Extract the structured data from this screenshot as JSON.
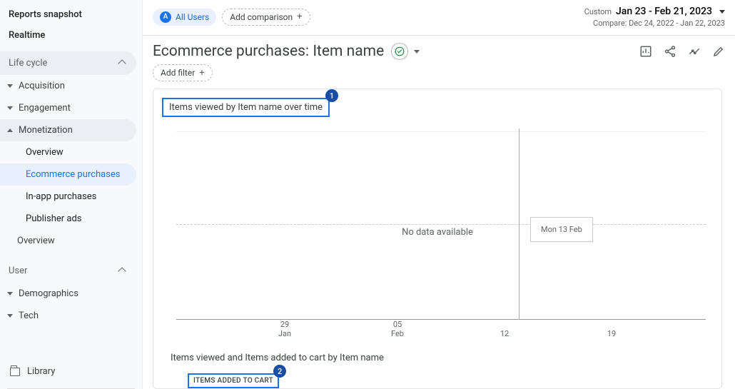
{
  "sidebar": {
    "top": [
      {
        "label": "Reports snapshot"
      },
      {
        "label": "Realtime"
      }
    ],
    "sections": [
      {
        "label": "Life cycle",
        "items": [
          {
            "label": "Acquisition"
          },
          {
            "label": "Engagement"
          },
          {
            "label": "Monetization",
            "expanded": true,
            "children": [
              {
                "label": "Overview"
              },
              {
                "label": "Ecommerce purchases",
                "selected": true
              },
              {
                "label": "In-app purchases"
              },
              {
                "label": "Publisher ads"
              }
            ]
          },
          {
            "label": "Overview"
          }
        ]
      },
      {
        "label": "User",
        "items": [
          {
            "label": "Demographics"
          },
          {
            "label": "Tech"
          }
        ]
      }
    ],
    "library_label": "Library"
  },
  "topbar": {
    "segment_letter": "A",
    "segment_label": "All Users",
    "add_comparison_label": "Add comparison",
    "custom_label": "Custom",
    "date_range": "Jan 23 - Feb 21, 2023",
    "compare_label": "Compare: Dec 24, 2022 - Jan 22, 2023"
  },
  "page": {
    "title": "Ecommerce purchases: Item name",
    "add_filter_label": "Add filter"
  },
  "callouts": {
    "one": "1",
    "two": "2"
  },
  "card1": {
    "title": "Items viewed by Item name over time",
    "no_data": "No data available",
    "tooltip": "Mon 13 Feb",
    "xticks": [
      {
        "d": "29",
        "m": "Jan"
      },
      {
        "d": "05",
        "m": "Feb"
      },
      {
        "d": "12",
        "m": ""
      },
      {
        "d": "19",
        "m": ""
      }
    ]
  },
  "card2": {
    "title": "Items viewed and Items added to cart by Item name",
    "column_label": "ITEMS ADDED TO CART"
  },
  "chart_data": {
    "type": "line",
    "title": "Items viewed by Item name over time",
    "x": [
      "2023-01-29",
      "2023-02-05",
      "2023-02-12",
      "2023-02-19"
    ],
    "series": [
      {
        "name": "Items viewed",
        "values": [
          null,
          null,
          null,
          null
        ]
      }
    ],
    "xlabel": "",
    "ylabel": "",
    "note": "No data available"
  }
}
